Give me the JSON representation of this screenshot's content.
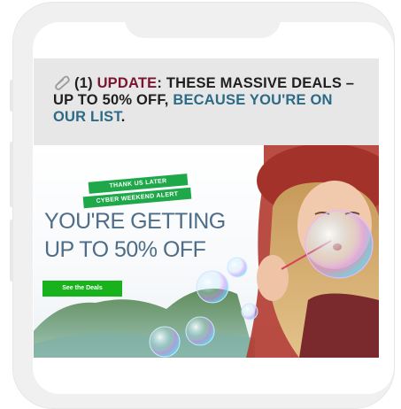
{
  "email_preview": {
    "subject": {
      "icon": "paperclip-icon",
      "part1": "(1) ",
      "part2": "UPDATE",
      "part3": ": THESE MASSIVE DEALS – UP TO 50% OFF, ",
      "part4": "BECAUSE YOU'RE ON OUR LIST",
      "part5": "."
    },
    "hero": {
      "tag_top": "THANK US LATER",
      "tag_bottom": "CYBER WEEKEND ALERT",
      "headline_line1": "YOU'RE GETTING",
      "headline_line2": "UP TO 50% OFF",
      "cta_label": "See the Deals"
    }
  },
  "colors": {
    "accent_red": "#7a1430",
    "accent_teal": "#2c6a86",
    "tag_green": "#1fa84a",
    "cta_green": "#17b21c",
    "headline_blue": "#4f6d86"
  }
}
